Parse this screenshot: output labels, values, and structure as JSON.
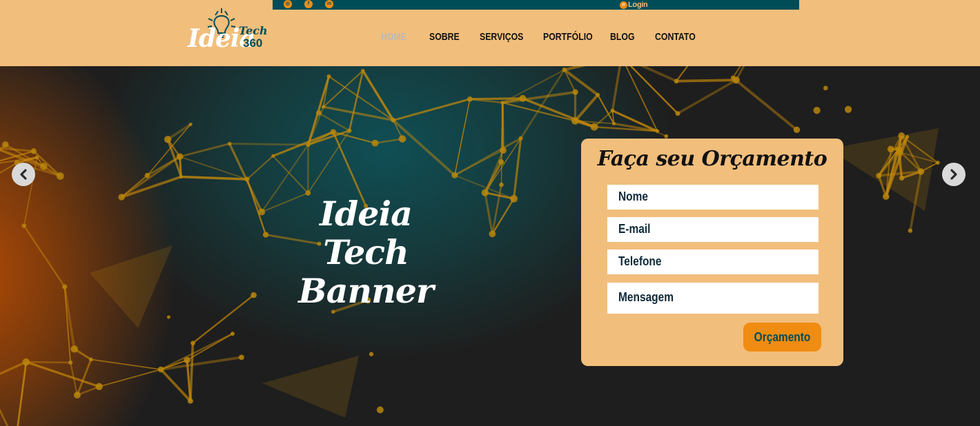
{
  "brand": {
    "name_main": "Ideia",
    "name_tech": "Tech",
    "name_number": "360",
    "accent_color": "#f08c12",
    "header_color": "#f2be7c",
    "topbar_color": "#004d57"
  },
  "topbar": {
    "social_icons": [
      "instagram-icon",
      "facebook-icon",
      "linkedin-icon"
    ],
    "login_label": "Login"
  },
  "nav": {
    "items": [
      {
        "label": "HOME",
        "active": true
      },
      {
        "label": "SOBRE",
        "active": false
      },
      {
        "label": "SERVIÇOS",
        "active": false
      },
      {
        "label": "PORTFÓLIO",
        "active": false
      },
      {
        "label": "BLOG",
        "active": false
      },
      {
        "label": "CONTATO",
        "active": false
      }
    ]
  },
  "hero": {
    "title_line1": "Ideia Tech",
    "title_line2": "Banner",
    "prev_icon": "chevron-left-icon",
    "next_icon": "chevron-right-icon"
  },
  "quote_form": {
    "title": "Faça seu Orçamento",
    "fields": {
      "name_placeholder": "Nome",
      "email_placeholder": "E-mail",
      "phone_placeholder": "Telefone",
      "message_placeholder": "Mensagem"
    },
    "submit_label": "Orçamento"
  }
}
